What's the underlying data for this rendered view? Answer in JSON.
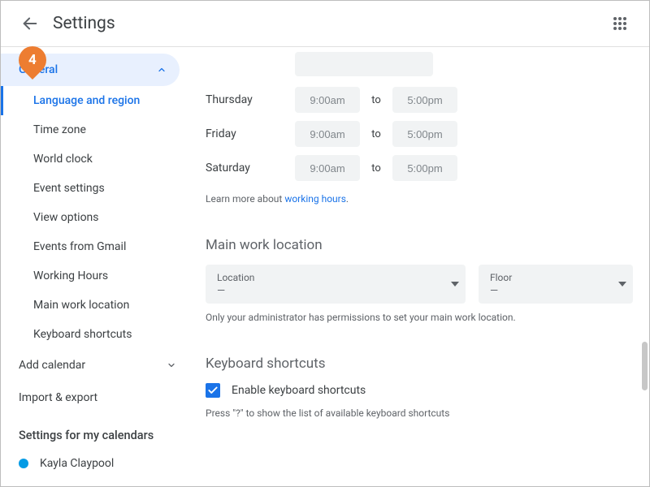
{
  "header": {
    "title": "Settings"
  },
  "callout": {
    "label": "4"
  },
  "sidebar": {
    "general_label": "General",
    "items": [
      "Language and region",
      "Time zone",
      "World clock",
      "Event settings",
      "View options",
      "Events from Gmail",
      "Working Hours",
      "Main work location",
      "Keyboard shortcuts"
    ],
    "add_calendar": "Add calendar",
    "import_export": "Import & export",
    "my_cal_title": "Settings for my calendars",
    "calendars": [
      "Kayla Claypool"
    ]
  },
  "working_hours": {
    "rows": [
      {
        "day": "Thursday",
        "start": "9:00am",
        "end": "5:00pm"
      },
      {
        "day": "Friday",
        "start": "9:00am",
        "end": "5:00pm"
      },
      {
        "day": "Saturday",
        "start": "9:00am",
        "end": "5:00pm"
      }
    ],
    "to": "to",
    "learn_prefix": "Learn more about ",
    "learn_link": "working hours"
  },
  "main_location": {
    "title": "Main work location",
    "location_label": "Location",
    "location_value": "—",
    "floor_label": "Floor",
    "floor_value": "—",
    "hint": "Only your administrator has permissions to set your main work location."
  },
  "keyboard": {
    "title": "Keyboard shortcuts",
    "checkbox_label": "Enable keyboard shortcuts",
    "checked": true,
    "hint": "Press \"?\" to show the list of available keyboard shortcuts"
  }
}
